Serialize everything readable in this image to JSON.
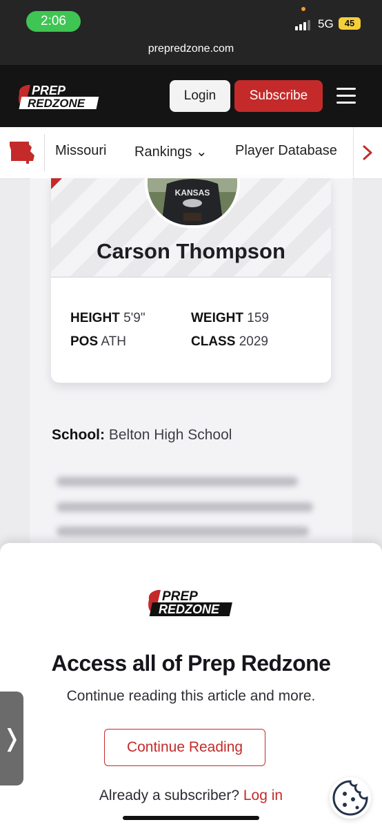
{
  "status": {
    "time": "2:06",
    "network": "5G",
    "battery": "45"
  },
  "browser": {
    "url": "prepredzone.com"
  },
  "header": {
    "logo_top": "PREP",
    "logo_bottom": "REDZONE",
    "login_label": "Login",
    "subscribe_label": "Subscribe",
    "brand_red": "#c42a2a"
  },
  "nav": {
    "items": [
      {
        "label": "Missouri"
      },
      {
        "label": "Rankings ⌄"
      },
      {
        "label": "Player Database"
      }
    ]
  },
  "player": {
    "name": "Carson Thompson",
    "shirt_text": "KANSAS",
    "stats": {
      "height_label": "HEIGHT",
      "height": "5'9\"",
      "weight_label": "WEIGHT",
      "weight": "159",
      "pos_label": "POS",
      "pos": "ATH",
      "class_label": "CLASS",
      "class": "2029"
    },
    "school_label": "School:",
    "school": "Belton High School"
  },
  "paywall": {
    "logo_top": "PREP",
    "logo_bottom": "REDZONE",
    "title": "Access all of Prep Redzone",
    "subtitle": "Continue reading this article and more.",
    "continue_label": "Continue Reading",
    "already_text": "Already a subscriber?",
    "login_link": "Log in"
  }
}
